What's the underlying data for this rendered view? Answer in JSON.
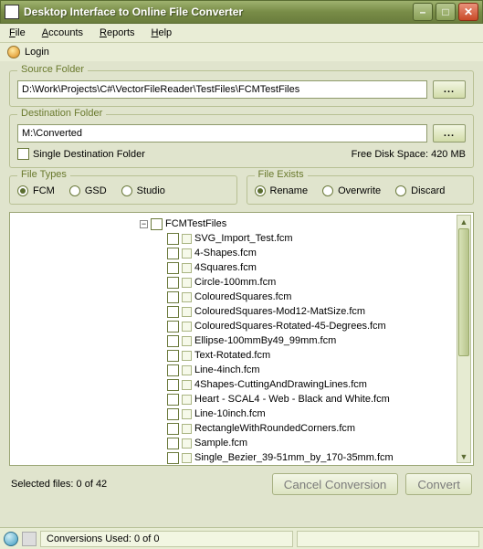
{
  "window": {
    "title": "Desktop Interface to Online File Converter"
  },
  "menu": {
    "file": "File",
    "accounts": "Accounts",
    "reports": "Reports",
    "help": "Help"
  },
  "login": {
    "label": "Login"
  },
  "source": {
    "title": "Source Folder",
    "path": "D:\\Work\\Projects\\C#\\VectorFileReader\\TestFiles\\FCMTestFiles",
    "browse": "..."
  },
  "dest": {
    "title": "Destination Folder",
    "path": "M:\\Converted",
    "browse": "...",
    "single_label": "Single Destination Folder",
    "free_space": "Free Disk Space: 420 MB"
  },
  "filetypes": {
    "title": "File Types",
    "opts": [
      "FCM",
      "GSD",
      "Studio"
    ],
    "selected": 0
  },
  "fileexists": {
    "title": "File Exists",
    "opts": [
      "Rename",
      "Overwrite",
      "Discard"
    ],
    "selected": 0
  },
  "tree": {
    "root": "FCMTestFiles",
    "items": [
      "SVG_Import_Test.fcm",
      "4-Shapes.fcm",
      "4Squares.fcm",
      "Circle-100mm.fcm",
      "ColouredSquares.fcm",
      "ColouredSquares-Mod12-MatSize.fcm",
      "ColouredSquares-Rotated-45-Degrees.fcm",
      "Ellipse-100mmBy49_99mm.fcm",
      "Text-Rotated.fcm",
      "Line-4inch.fcm",
      "4Shapes-CuttingAndDrawingLines.fcm",
      "Heart - SCAL4 - Web - Black and White.fcm",
      "Line-10inch.fcm",
      "RectangleWithRoundedCorners.fcm",
      "Sample.fcm",
      "Single_Bezier_39-51mm_by_170-35mm.fcm"
    ]
  },
  "selected_label": "Selected files: 0 of 42",
  "buttons": {
    "cancel": "Cancel Conversion",
    "convert": "Convert"
  },
  "status": {
    "conversions": "Conversions Used: 0 of 0"
  }
}
